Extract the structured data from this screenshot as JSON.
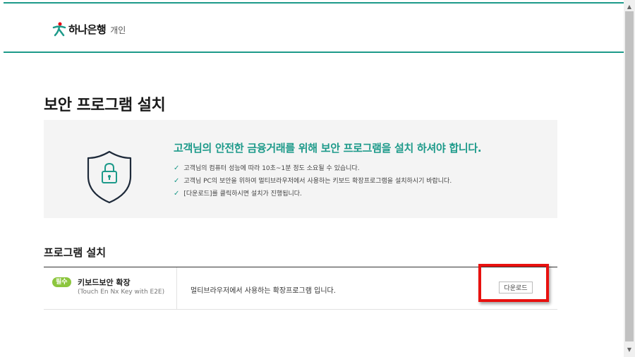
{
  "header": {
    "logo_text": "하나은행",
    "logo_sub": "개인"
  },
  "page": {
    "title": "보안 프로그램 설치"
  },
  "info": {
    "headline": "고객님의 안전한 금융거래를 위해 보안 프로그램을 설치 하셔야 합니다.",
    "bullets": [
      "고객님의 컴퓨터 성능에 따라 10초~1분 정도 소요될 수 있습니다.",
      "고객님 PC의 보안을 위하여 멀티브라우저에서 사용하는 키보드 확장프로그램을 설치하시기 바랍니다.",
      "[다운로드]를 클릭하시면 설치가 진행됩니다."
    ]
  },
  "install": {
    "section_title": "프로그램 설치",
    "row": {
      "badge": "필수",
      "name": "키보드보안 확장",
      "subname": "(Touch En Nx Key with E2E)",
      "description": "멀티브라우저에서 사용하는 확장프로그램 입니다.",
      "button": "다운로드"
    }
  },
  "colors": {
    "accent": "#1d9a8a",
    "badge": "#8cc63e",
    "highlight": "#e8110f",
    "panel": "#f4f4f4"
  },
  "icons": {
    "logo": "hana-logo-icon",
    "shield": "shield-lock-icon",
    "check": "check-icon"
  }
}
